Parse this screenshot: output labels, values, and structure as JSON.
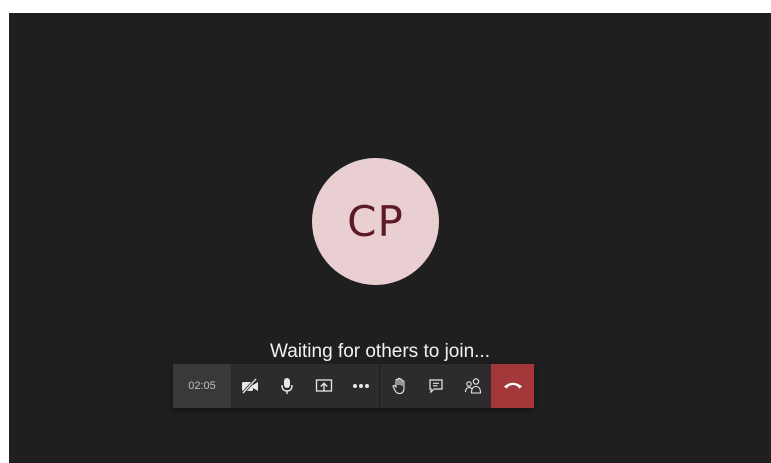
{
  "call": {
    "participant_initials": "CP",
    "status_text": "Waiting for others to join...",
    "timer": "02:05"
  },
  "colors": {
    "stage_background": "#201f1f",
    "avatar_background": "#e9cfd1",
    "avatar_text": "#5c1a24",
    "toolbar_background": "#2d2c2c",
    "hangup_background": "#a4373a"
  },
  "toolbar": {
    "icons": [
      "camera-off-icon",
      "microphone-icon",
      "share-screen-icon",
      "more-options-icon",
      "raise-hand-icon",
      "chat-icon",
      "participants-icon",
      "hang-up-icon"
    ]
  }
}
